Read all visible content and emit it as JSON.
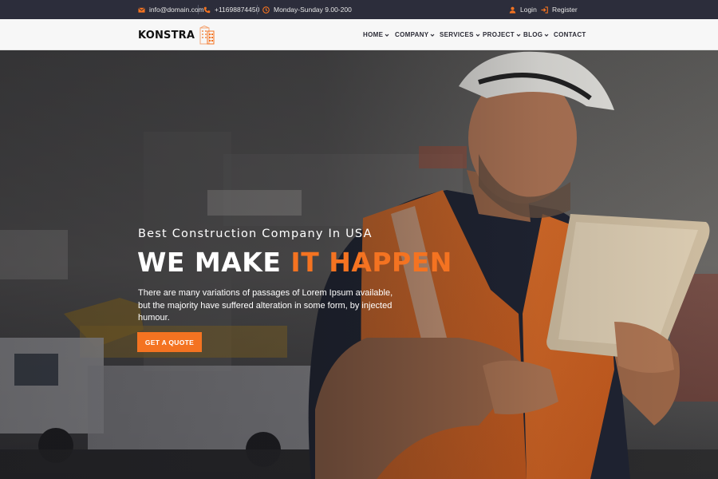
{
  "colors": {
    "accent": "#f47321",
    "topbar_bg": "#2c2d3b",
    "header_bg": "#f7f7f7",
    "nav_text": "#2a2a35"
  },
  "topbar": {
    "email": {
      "icon": "envelope-icon",
      "text": "info@domain.com"
    },
    "phone": {
      "icon": "phone-icon",
      "text": "+11698874450"
    },
    "hours": {
      "icon": "clock-icon",
      "text": "Monday-Sunday 9.00-200"
    },
    "login": {
      "icon": "user-icon",
      "text": "Login"
    },
    "register": {
      "icon": "sign-in-icon",
      "text": "Register"
    }
  },
  "header": {
    "logo_text": "KONSTRA",
    "logo_icon": "building-icon",
    "nav": [
      {
        "label": "HOME",
        "dropdown": true
      },
      {
        "label": "COMPANY",
        "dropdown": true
      },
      {
        "label": "SERVICES",
        "dropdown": true
      },
      {
        "label": "PROJECT",
        "dropdown": true
      },
      {
        "label": "BLOG",
        "dropdown": true
      },
      {
        "label": "CONTACT",
        "dropdown": false
      }
    ]
  },
  "hero": {
    "kicker": "Best Construction Company In USA",
    "headline_white": "WE MAKE ",
    "headline_accent": "IT HAPPEN",
    "description": "There are many variations of passages of Lorem Ipsum available, but the majority have suffered alteration in some form, by injected humour.",
    "cta_label": "GET A QUOTE"
  }
}
